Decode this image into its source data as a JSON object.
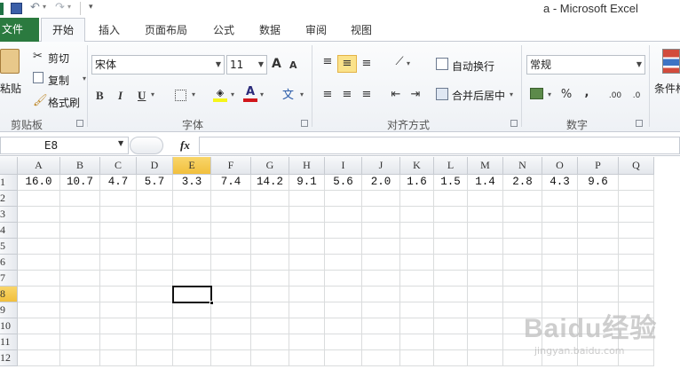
{
  "window": {
    "title": "a - Microsoft Excel",
    "qat_more": "▾"
  },
  "tabs": [
    {
      "label": "文件"
    },
    {
      "label": "开始"
    },
    {
      "label": "插入"
    },
    {
      "label": "页面布局"
    },
    {
      "label": "公式"
    },
    {
      "label": "数据"
    },
    {
      "label": "审阅"
    },
    {
      "label": "视图"
    }
  ],
  "ribbon": {
    "clipboard": {
      "paste": "粘贴",
      "cut": "剪切",
      "copy": "复制",
      "format_painter": "格式刷",
      "group": "剪贴板"
    },
    "font": {
      "name": "宋体",
      "size": "11",
      "group": "字体",
      "bold": "B",
      "italic": "I",
      "underline": "U",
      "grow": "A",
      "shrink": "A",
      "phonetic": "文"
    },
    "alignment": {
      "wrap": "自动换行",
      "merge": "合并后居中",
      "group": "对齐方式"
    },
    "number": {
      "format": "常规",
      "percent": "%",
      "comma": ",",
      "inc_dec": ".00",
      "dec_dec": ".0",
      "group": "数字"
    },
    "styles": {
      "conditional": "条件格"
    }
  },
  "formula_bar": {
    "name_box": "E8",
    "fx": "fx",
    "value": ""
  },
  "sheet": {
    "columns": [
      "A",
      "B",
      "C",
      "D",
      "E",
      "F",
      "G",
      "H",
      "I",
      "J",
      "K",
      "L",
      "M",
      "N",
      "O",
      "P",
      "Q"
    ],
    "active_column": "E",
    "rows": [
      "1",
      "2",
      "3",
      "4",
      "5",
      "6",
      "7",
      "8",
      "9",
      "10",
      "11",
      "12"
    ],
    "active_row": "8",
    "row1_values": [
      "16.0",
      "10.7",
      "4.7",
      "5.7",
      "3.3",
      "7.4",
      "14.2",
      "9.1",
      "5.6",
      "2.0",
      "1.6",
      "1.5",
      "1.4",
      "2.8",
      "4.3",
      "9.6",
      ""
    ],
    "selected_cell": "E8"
  },
  "watermark": {
    "text": "Baidu经验",
    "sub": "jingyan.baidu.com"
  },
  "colors": {
    "file_tab": "#2b7a3f",
    "highlight": "#f1bf3d",
    "ribbon": "#eef1f5"
  }
}
